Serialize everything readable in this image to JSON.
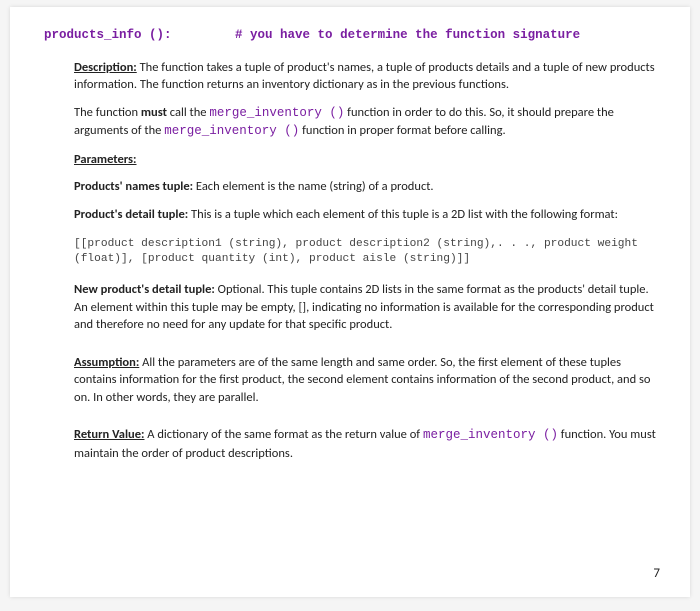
{
  "signature": {
    "fn_name": "products_info ():",
    "comment": "# you have to determine the function signature"
  },
  "description": {
    "label": "Description:",
    "text": " The function takes a tuple of product's names, a tuple of products details and a tuple of new products information. The function returns an inventory dictionary as in the previous functions."
  },
  "must_line": {
    "t1": "The function ",
    "must": "must",
    "t2": " call the ",
    "fn1": "merge_inventory ()",
    "t3": "  function in order to do this. So, it should prepare the arguments of the ",
    "fn2": "merge_inventory ()",
    "t4": "  function in proper format before calling."
  },
  "parameters_label": "Parameters:",
  "params": {
    "names": {
      "label": "Products' names tuple:",
      "text": " Each element is the name (string) of a product."
    },
    "detail": {
      "label": "Product's detail tuple:",
      "text": " This is a tuple which each element of this tuple is a 2D list with the following format:"
    },
    "code": "[[product description1 (string), product description2 (string),. . ., product weight (float)], [product quantity (int), product aisle (string)]]",
    "new_detail": {
      "label": "New product's detail tuple:",
      "text": " Optional. This tuple contains 2D lists in the same format as the products' detail tuple. An element within this tuple may be empty, [], indicating no information is available for the corresponding product and therefore no need for any update for that specific product."
    }
  },
  "assumption": {
    "label": "Assumption:",
    "text": " All the parameters are of the same length and same order. So, the first element of these tuples contains information for the first product, the second element contains information of the second product, and so on. In other words, they are parallel."
  },
  "return": {
    "label": "Return Value:",
    "t1": " A dictionary of the same format as the return value of ",
    "fn": "merge_inventory ()",
    "t2": " function. You must maintain the order of product descriptions."
  },
  "page_number": "7"
}
